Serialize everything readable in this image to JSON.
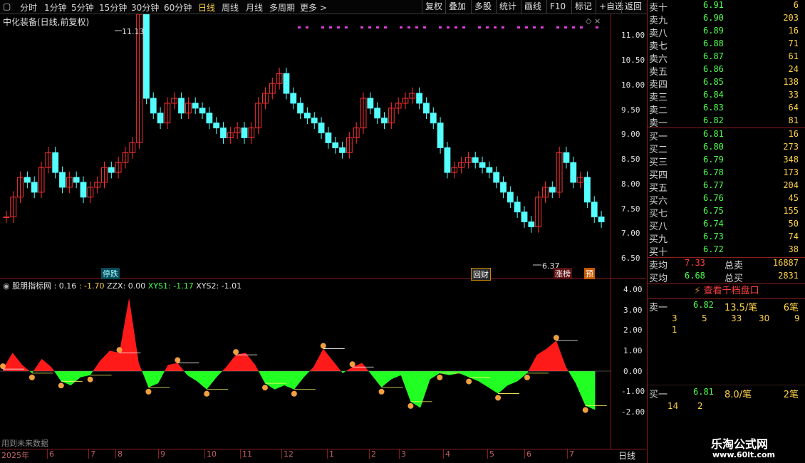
{
  "toolbar": {
    "periods": [
      "分时",
      "1分钟",
      "5分钟",
      "15分钟",
      "30分钟",
      "60分钟",
      "日线",
      "周线",
      "月线",
      "多周期",
      "更多 >"
    ],
    "active": "日线",
    "tools": [
      "复权",
      "叠加",
      "多股",
      "统计",
      "画线",
      "F10",
      "标记",
      "+自选",
      "返回"
    ]
  },
  "stock": {
    "title": "中化装备(日线,前复权)",
    "max_label": "11.13",
    "min_label": "6.37"
  },
  "price_axis": [
    "11.00",
    "10.50",
    "10.00",
    "9.50",
    "9.00",
    "8.50",
    "8.00",
    "7.50",
    "7.00",
    "6.50"
  ],
  "markers": {
    "m1": "停跌",
    "m2": "回财",
    "m3": "涨榜",
    "m4": "预"
  },
  "indicator": {
    "name": "股朋指标网",
    "v1": ": 0.16",
    "v2": ": -1.70",
    "zzx": "ZZX: 0.00",
    "xys1": "XYS1: -1.17",
    "xys2": "XYS2: -1.01"
  },
  "ind_axis": [
    "4.00",
    "3.00",
    "2.00",
    "1.00",
    "0.00",
    "-1.00",
    "-2.00"
  ],
  "footnote": "用到未来数据",
  "date_axis": {
    "year": "2025年",
    "months": [
      "6",
      "7",
      "8",
      "9",
      "10",
      "11",
      "12",
      "1",
      "2",
      "3",
      "4",
      "5",
      "6",
      "7"
    ],
    "period": "日线"
  },
  "orderbook": {
    "asks": [
      {
        "label": "卖十",
        "price": "6.91",
        "vol": "6"
      },
      {
        "label": "卖九",
        "price": "6.90",
        "vol": "203"
      },
      {
        "label": "卖八",
        "price": "6.89",
        "vol": "16"
      },
      {
        "label": "卖七",
        "price": "6.88",
        "vol": "71"
      },
      {
        "label": "卖六",
        "price": "6.87",
        "vol": "61"
      },
      {
        "label": "卖五",
        "price": "6.86",
        "vol": "24"
      },
      {
        "label": "卖四",
        "price": "6.85",
        "vol": "138"
      },
      {
        "label": "卖三",
        "price": "6.84",
        "vol": "33"
      },
      {
        "label": "卖二",
        "price": "6.83",
        "vol": "64"
      },
      {
        "label": "卖一",
        "price": "6.82",
        "vol": "81"
      }
    ],
    "bids": [
      {
        "label": "买一",
        "price": "6.81",
        "vol": "16"
      },
      {
        "label": "买二",
        "price": "6.80",
        "vol": "273"
      },
      {
        "label": "买三",
        "price": "6.79",
        "vol": "348"
      },
      {
        "label": "买四",
        "price": "6.78",
        "vol": "173"
      },
      {
        "label": "买五",
        "price": "6.77",
        "vol": "204"
      },
      {
        "label": "买六",
        "price": "6.76",
        "vol": "45"
      },
      {
        "label": "买七",
        "price": "6.75",
        "vol": "155"
      },
      {
        "label": "买八",
        "price": "6.74",
        "vol": "50"
      },
      {
        "label": "买九",
        "price": "6.73",
        "vol": "74"
      },
      {
        "label": "买十",
        "price": "6.72",
        "vol": "38"
      }
    ],
    "avg_sell": {
      "label": "卖均",
      "price": "7.33",
      "total_label": "总卖",
      "total": "16887"
    },
    "avg_buy": {
      "label": "买均",
      "price": "6.68",
      "total_label": "总买",
      "total": "2831"
    },
    "thousand_btn": "查看千档盘口",
    "sell1": {
      "label": "卖一",
      "price": "6.82",
      "per": "13.5/笔",
      "count": "6笔",
      "queue": [
        "3",
        "5",
        "33",
        "30",
        "9",
        "1"
      ]
    },
    "buy1": {
      "label": "买一",
      "price": "6.81",
      "per": "8.0/笔",
      "count": "2笔",
      "queue": [
        "14",
        "2"
      ]
    }
  },
  "watermark": {
    "cn": "乐淘公式网",
    "url": "www.60lt.com"
  },
  "colors": {
    "up": "#ff3232",
    "down": "#54ffff",
    "ask_price": "#4cff4c",
    "vol": "#ffd24a",
    "frame": "#8a1c1c"
  }
}
